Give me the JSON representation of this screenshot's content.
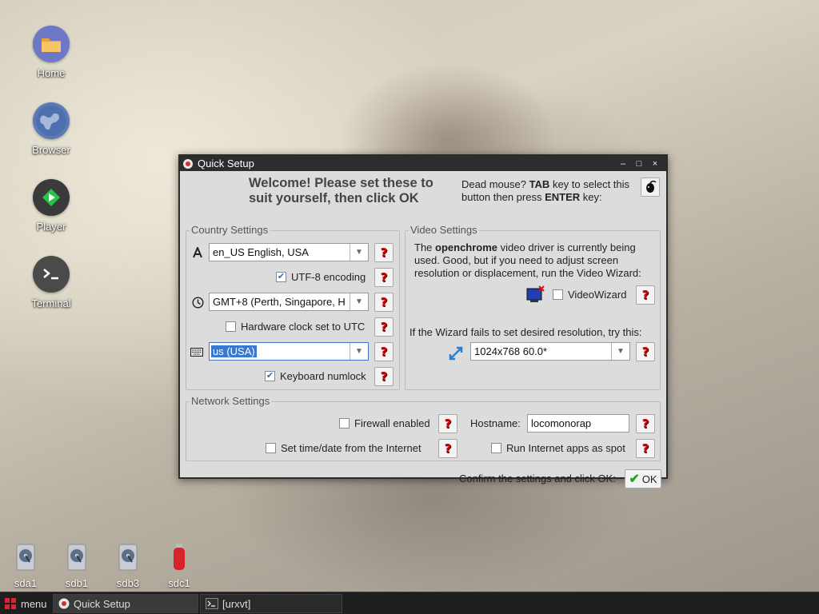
{
  "desktop": {
    "icons": [
      {
        "label": "Home"
      },
      {
        "label": "Browser"
      },
      {
        "label": "Player"
      },
      {
        "label": "Terminal"
      }
    ],
    "drives": [
      {
        "label": "sda1"
      },
      {
        "label": "sdb1"
      },
      {
        "label": "sdb3"
      },
      {
        "label": "sdc1"
      }
    ]
  },
  "window": {
    "title": "Quick Setup",
    "controls": {
      "minimize": "–",
      "maximize": "□",
      "close": "×"
    },
    "welcome_line1": "Welcome! Please set these to",
    "welcome_line2": "suit yourself, then click OK",
    "deadmouse": {
      "pre": "Dead mouse? ",
      "tab": "TAB",
      "mid1": " key to select this",
      "mid2": "button then press ",
      "enter": "ENTER",
      "end": " key:"
    },
    "country": {
      "title": "Country Settings",
      "locale_value": "en_US   English, USA",
      "utf8_label": "UTF-8 encoding",
      "utf8_checked": true,
      "timezone_value": "GMT+8 (Perth, Singapore, H",
      "hwclock_label": "Hardware clock set to UTC",
      "hwclock_checked": false,
      "keyboard_value": "us         (USA)",
      "numlock_label": "Keyboard numlock",
      "numlock_checked": true
    },
    "video": {
      "title": "Video Settings",
      "desc_pre": "The ",
      "desc_driver": "openchrome",
      "desc_post1": " video driver is currently being",
      "desc_line2": "used. Good, but if you need to adjust screen",
      "desc_line3": "resolution or displacement, run the Video Wizard:",
      "wizard_label": "VideoWizard",
      "wizard_checked": false,
      "fallback_text": "If the Wizard fails to set desired resolution, try this:",
      "resolution_value": "1024x768   60.0*"
    },
    "network": {
      "title": "Network Settings",
      "firewall_label": "Firewall enabled",
      "firewall_checked": false,
      "hostname_label": "Hostname:",
      "hostname_value": "locomonorap",
      "timedate_label": "Set time/date from the Internet",
      "timedate_checked": false,
      "spot_label": "Run Internet apps as spot",
      "spot_checked": false
    },
    "confirm_text": "Confirm the settings and click OK:",
    "ok_label": "OK",
    "help_glyph": "?"
  },
  "taskbar": {
    "menu_label": "menu",
    "tasks": [
      {
        "label": "Quick Setup"
      },
      {
        "label": "[urxvt]"
      }
    ]
  },
  "colors": {
    "help_red": "#cc0000",
    "selection_blue": "#3a78d0",
    "check_blue": "#2a6ebf",
    "ok_green": "#2aa02a"
  }
}
